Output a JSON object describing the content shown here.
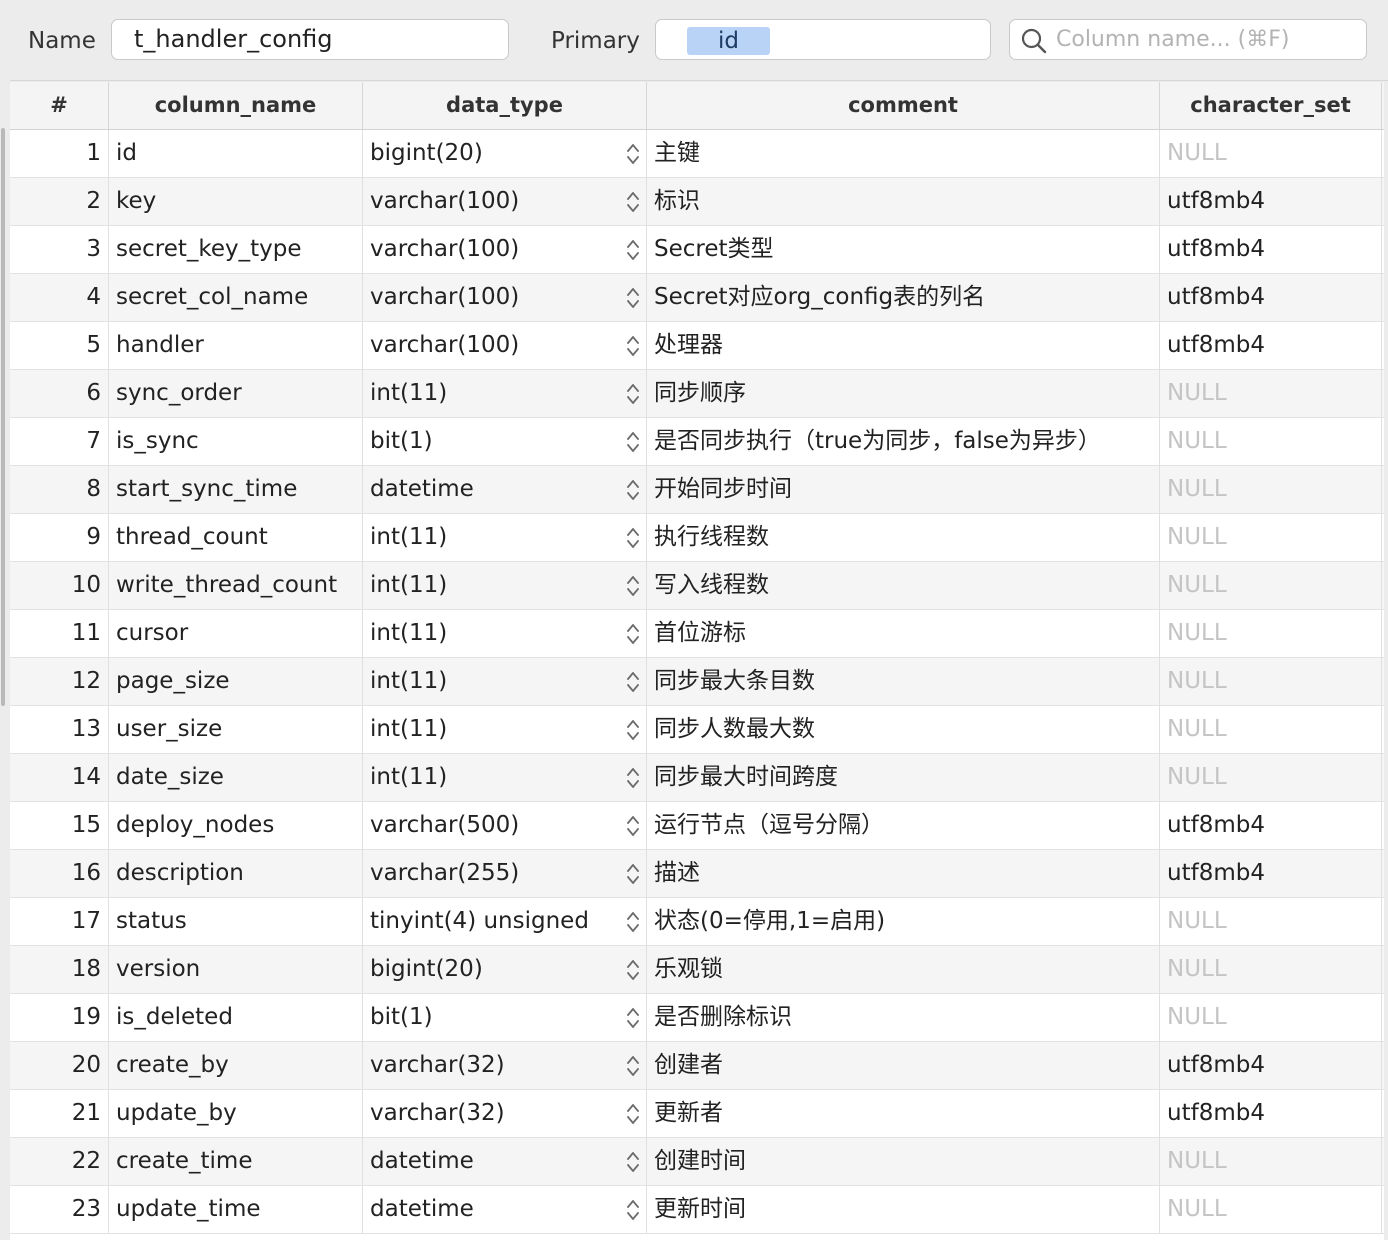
{
  "toolbar": {
    "name_label": "Name",
    "name_value": "t_handler_config",
    "primary_label": "Primary",
    "primary_key": "id",
    "search_placeholder": "Column name... (⌘F)"
  },
  "table": {
    "headers": [
      "#",
      "column_name",
      "data_type",
      "comment",
      "character_set"
    ],
    "rows": [
      {
        "num": "1",
        "column_name": "id",
        "data_type": "bigint(20)",
        "comment": "主键",
        "character_set": "NULL"
      },
      {
        "num": "2",
        "column_name": "key",
        "data_type": "varchar(100)",
        "comment": "标识",
        "character_set": "utf8mb4"
      },
      {
        "num": "3",
        "column_name": "secret_key_type",
        "data_type": "varchar(100)",
        "comment": "Secret类型",
        "character_set": "utf8mb4"
      },
      {
        "num": "4",
        "column_name": "secret_col_name",
        "data_type": "varchar(100)",
        "comment": "Secret对应org_config表的列名",
        "character_set": "utf8mb4"
      },
      {
        "num": "5",
        "column_name": "handler",
        "data_type": "varchar(100)",
        "comment": "处理器",
        "character_set": "utf8mb4"
      },
      {
        "num": "6",
        "column_name": "sync_order",
        "data_type": "int(11)",
        "comment": "同步顺序",
        "character_set": "NULL"
      },
      {
        "num": "7",
        "column_name": "is_sync",
        "data_type": "bit(1)",
        "comment": "是否同步执行（true为同步，false为异步）",
        "character_set": "NULL"
      },
      {
        "num": "8",
        "column_name": "start_sync_time",
        "data_type": "datetime",
        "comment": "开始同步时间",
        "character_set": "NULL"
      },
      {
        "num": "9",
        "column_name": "thread_count",
        "data_type": "int(11)",
        "comment": "执行线程数",
        "character_set": "NULL"
      },
      {
        "num": "10",
        "column_name": "write_thread_count",
        "data_type": "int(11)",
        "comment": "写入线程数",
        "character_set": "NULL"
      },
      {
        "num": "11",
        "column_name": "cursor",
        "data_type": "int(11)",
        "comment": "首位游标",
        "character_set": "NULL"
      },
      {
        "num": "12",
        "column_name": "page_size",
        "data_type": "int(11)",
        "comment": "同步最大条目数",
        "character_set": "NULL"
      },
      {
        "num": "13",
        "column_name": "user_size",
        "data_type": "int(11)",
        "comment": "同步人数最大数",
        "character_set": "NULL"
      },
      {
        "num": "14",
        "column_name": "date_size",
        "data_type": "int(11)",
        "comment": "同步最大时间跨度",
        "character_set": "NULL"
      },
      {
        "num": "15",
        "column_name": "deploy_nodes",
        "data_type": "varchar(500)",
        "comment": "运行节点（逗号分隔）",
        "character_set": "utf8mb4"
      },
      {
        "num": "16",
        "column_name": "description",
        "data_type": "varchar(255)",
        "comment": "描述",
        "character_set": "utf8mb4"
      },
      {
        "num": "17",
        "column_name": "status",
        "data_type": "tinyint(4) unsigned",
        "comment": "状态(0=停用,1=启用)",
        "character_set": "NULL"
      },
      {
        "num": "18",
        "column_name": "version",
        "data_type": "bigint(20)",
        "comment": "乐观锁",
        "character_set": "NULL"
      },
      {
        "num": "19",
        "column_name": "is_deleted",
        "data_type": "bit(1)",
        "comment": "是否删除标识",
        "character_set": "NULL"
      },
      {
        "num": "20",
        "column_name": "create_by",
        "data_type": "varchar(32)",
        "comment": "创建者",
        "character_set": "utf8mb4"
      },
      {
        "num": "21",
        "column_name": "update_by",
        "data_type": "varchar(32)",
        "comment": "更新者",
        "character_set": "utf8mb4"
      },
      {
        "num": "22",
        "column_name": "create_time",
        "data_type": "datetime",
        "comment": "创建时间",
        "character_set": "NULL"
      },
      {
        "num": "23",
        "column_name": "update_time",
        "data_type": "datetime",
        "comment": "更新时间",
        "character_set": "NULL"
      }
    ]
  },
  "icons": {
    "search": "search-icon",
    "stepper": "stepper-icon"
  }
}
